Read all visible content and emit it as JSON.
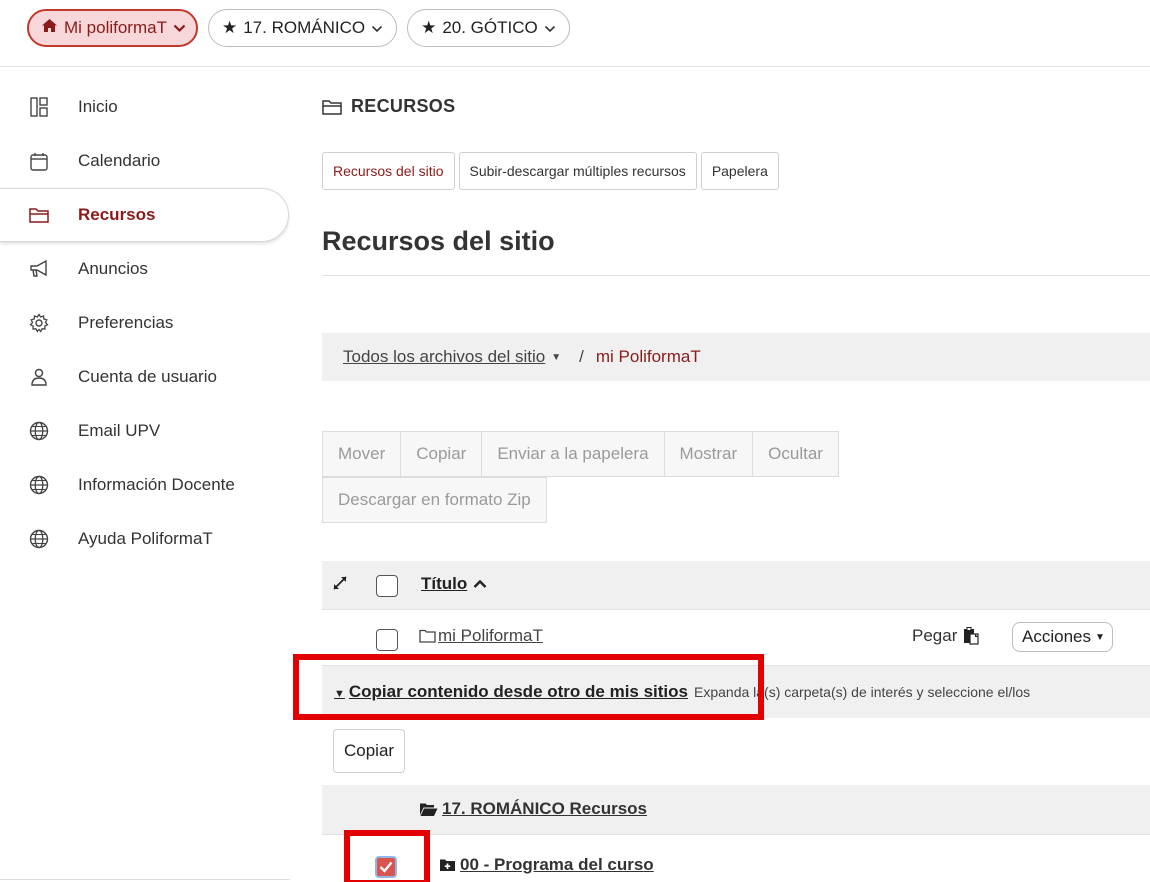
{
  "site_tabs": [
    {
      "label": "Mi poliformaT",
      "icon": "home-icon",
      "active": true
    },
    {
      "label": "17. ROMÁNICO",
      "icon": "star-icon",
      "active": false
    },
    {
      "label": "20. GÓTICO",
      "icon": "star-icon",
      "active": false
    }
  ],
  "sidebar": {
    "items": [
      {
        "label": "Inicio",
        "icon": "dashboard-icon"
      },
      {
        "label": "Calendario",
        "icon": "calendar-icon"
      },
      {
        "label": "Recursos",
        "icon": "folder-icon",
        "active": true
      },
      {
        "label": "Anuncios",
        "icon": "megaphone-icon"
      },
      {
        "label": "Preferencias",
        "icon": "gear-icon"
      },
      {
        "label": "Cuenta de usuario",
        "icon": "user-icon"
      },
      {
        "label": "Email UPV",
        "icon": "globe-icon"
      },
      {
        "label": "Información Docente",
        "icon": "globe-icon"
      },
      {
        "label": "Ayuda PoliformaT",
        "icon": "globe-icon"
      }
    ]
  },
  "main": {
    "tool_title": "RECURSOS",
    "subtabs": [
      "Recursos del sitio",
      "Subir-descargar múltiples recursos",
      "Papelera"
    ],
    "page_title": "Recursos del sitio",
    "breadcrumb": {
      "root": "Todos los archivos del sitio",
      "separator": "/",
      "current": "mi PoliformaT"
    },
    "actions_row1": [
      "Mover",
      "Copiar",
      "Enviar a la papelera",
      "Mostrar",
      "Ocultar"
    ],
    "actions_row2": [
      "Descargar en formato Zip"
    ],
    "table": {
      "title_header": "Título",
      "rows": [
        {
          "name": "mi PoliformaT",
          "paste_label": "Pegar",
          "actions_label": "Acciones"
        }
      ]
    },
    "copy_section": {
      "link": "Copiar contenido desde otro de mis sitios",
      "hint": "Expanda la(s) carpeta(s) de interés y seleccione el/los",
      "button": "Copiar",
      "source": "17. ROMÁNICO Recursos",
      "item": "00 - Programa del curso",
      "item_checked": true
    }
  },
  "colors": {
    "accent": "#8b1a1a",
    "highlight": "#e30000",
    "active_tab_bg": "#f8d7da"
  }
}
